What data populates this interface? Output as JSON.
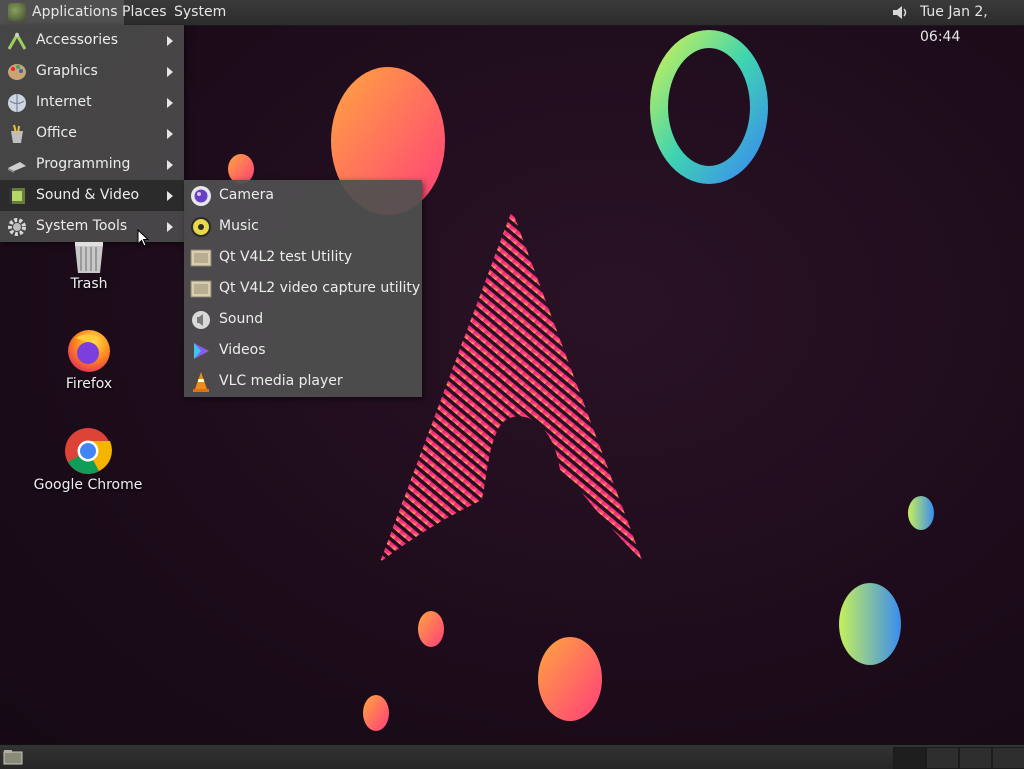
{
  "top_panel": {
    "menus": {
      "applications": "Applications",
      "places": "Places",
      "system": "System"
    },
    "icons": {
      "apps": "arch-logo-icon",
      "volume": "speaker-volume-icon"
    },
    "clock": "Tue Jan  2, 06:44"
  },
  "applications_menu": {
    "items": [
      {
        "label": "Accessories",
        "icon": "accessories-icon"
      },
      {
        "label": "Graphics",
        "icon": "graphics-icon"
      },
      {
        "label": "Internet",
        "icon": "internet-globe-icon"
      },
      {
        "label": "Office",
        "icon": "office-icon"
      },
      {
        "label": "Programming",
        "icon": "programming-icon"
      },
      {
        "label": "Sound & Video",
        "icon": "multimedia-icon",
        "active": true
      },
      {
        "label": "System Tools",
        "icon": "gear-icon"
      }
    ]
  },
  "sound_video_submenu": {
    "items": [
      {
        "label": "Camera",
        "icon": "camera-icon"
      },
      {
        "label": "Music",
        "icon": "music-icon"
      },
      {
        "label": "Qt V4L2 test Utility",
        "icon": "qv4l2-icon"
      },
      {
        "label": "Qt V4L2 video capture utility",
        "icon": "qvidcap-icon"
      },
      {
        "label": "Sound",
        "icon": "sound-icon"
      },
      {
        "label": "Videos",
        "icon": "videos-icon"
      },
      {
        "label": "VLC media player",
        "icon": "vlc-cone-icon"
      }
    ]
  },
  "desktop": {
    "icons": [
      {
        "label": "Trash",
        "icon": "trash-icon"
      },
      {
        "label": "Firefox",
        "icon": "firefox-icon"
      },
      {
        "label": "Google Chrome",
        "icon": "chrome-icon"
      }
    ]
  },
  "bottom_panel": {
    "icons": {
      "show_desktop": "show-desktop-icon"
    },
    "workspaces": [
      {
        "active": true
      },
      {
        "active": false
      },
      {
        "active": false
      },
      {
        "active": false
      }
    ]
  },
  "colors": {
    "desktop_bg": "#1d0c1b",
    "panel": "#2c2c2c",
    "menu": "#4a4a4a",
    "menu_active": "#2b2b2b"
  }
}
